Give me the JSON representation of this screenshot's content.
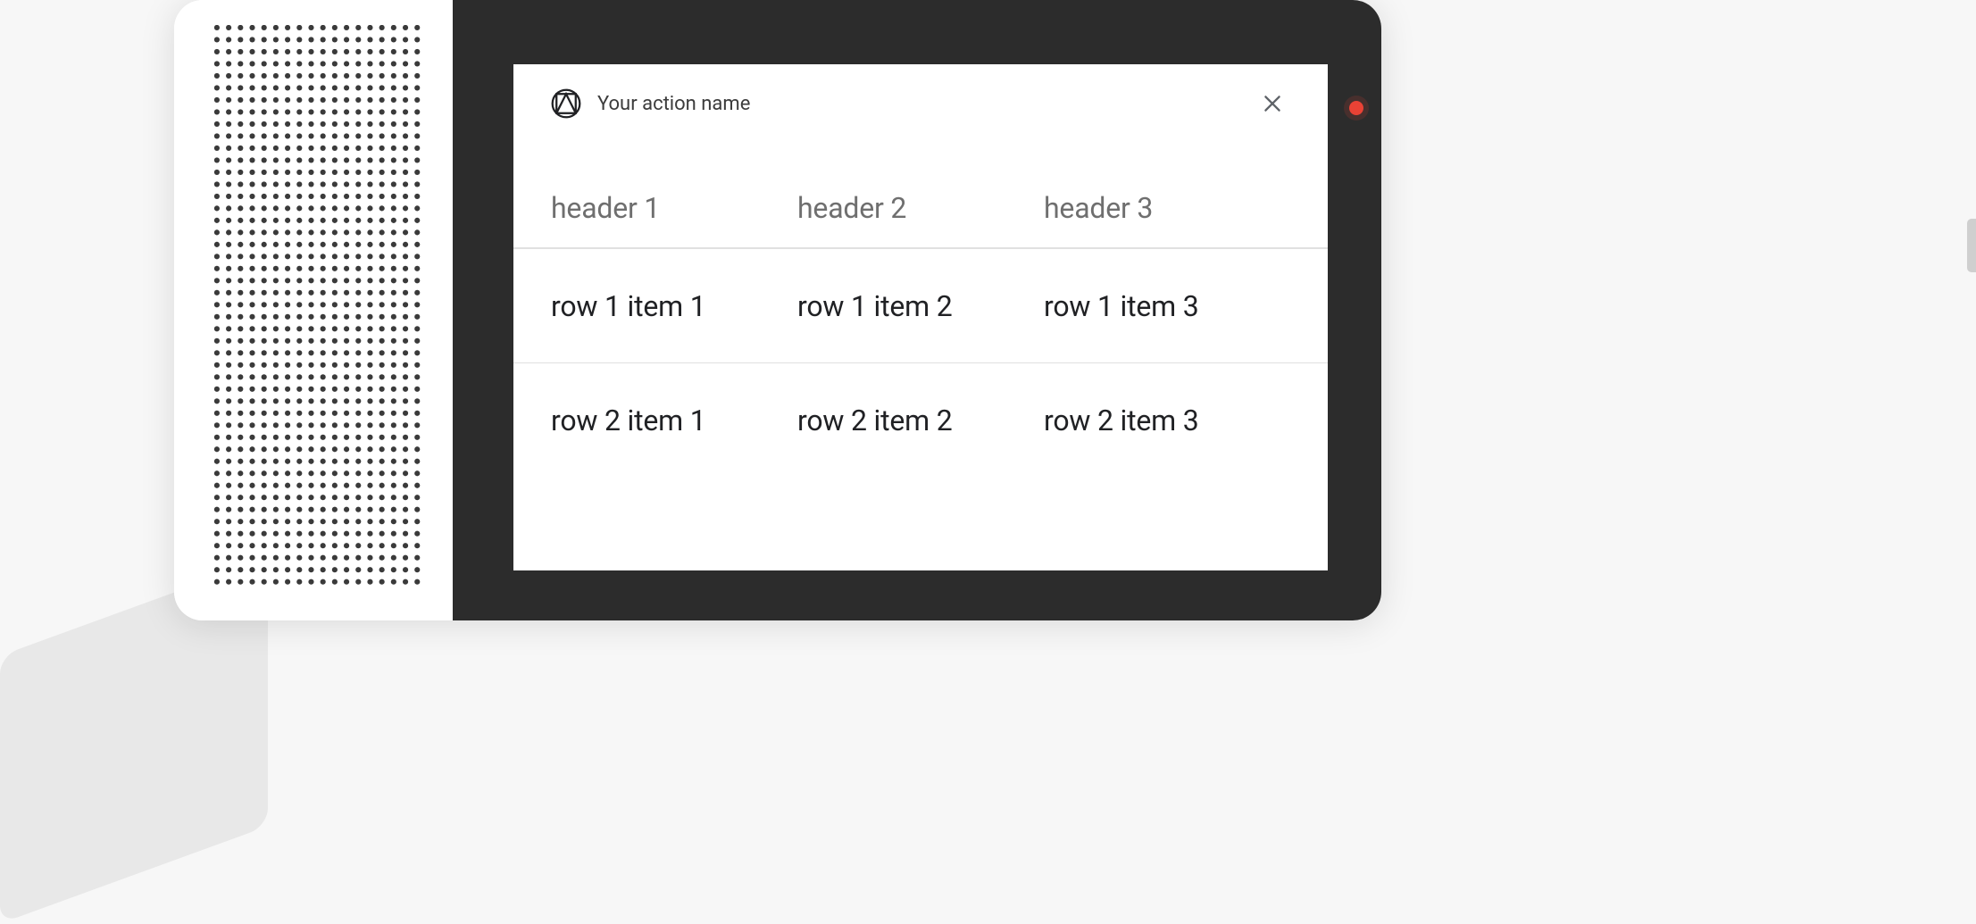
{
  "card": {
    "title": "Your action name",
    "icon_name": "material-design-logo-icon",
    "close_icon_name": "close-icon"
  },
  "table": {
    "headers": [
      "header 1",
      "header 2",
      "header 3"
    ],
    "rows": [
      [
        "row 1 item 1",
        "row 1 item 2",
        "row 1 item 3"
      ],
      [
        "row 2 item 1",
        "row 2 item 2",
        "row 2 item 3"
      ]
    ]
  }
}
